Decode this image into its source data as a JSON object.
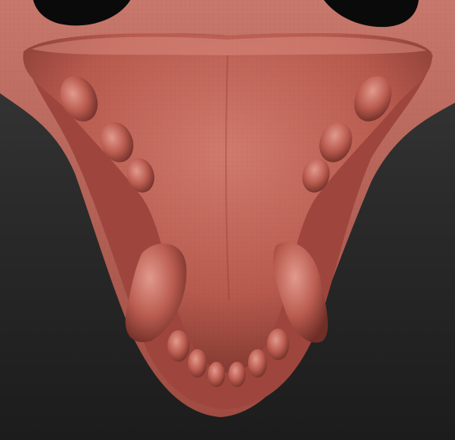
{
  "viewport": {
    "background_top": "#3a3a3a",
    "background_bottom": "#1c1c1c"
  },
  "model": {
    "name_icon": "sculpted-creature-jaw-icon",
    "base_color": "#b85a4e",
    "shadow_color": "#7a342c",
    "highlight_color": "#d98a7e",
    "rim_color": "#c8786c"
  }
}
